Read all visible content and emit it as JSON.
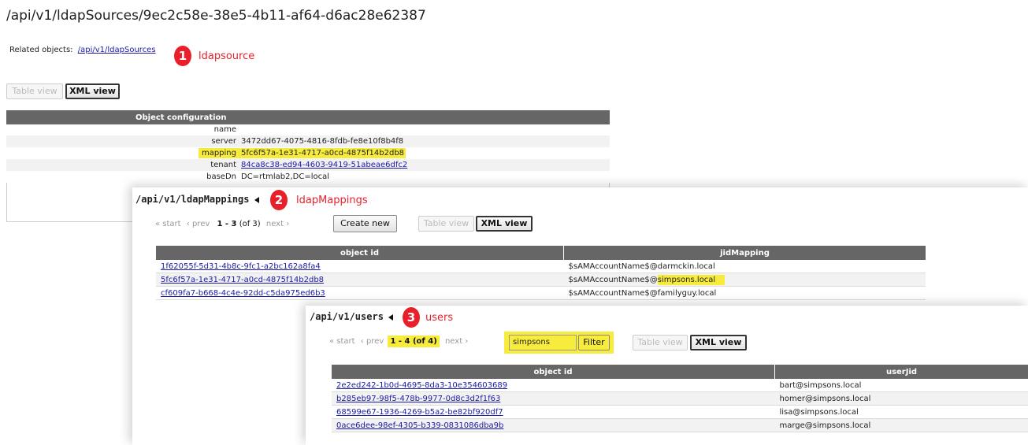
{
  "page_title": "/api/v1/ldapSources/9ec2c58e-38e5-4b11-af64-d6ac28e62387",
  "related": {
    "label": "Related objects:",
    "link": "/api/v1/ldapSources"
  },
  "annotations": [
    {
      "num": "1",
      "text": "ldapsource"
    },
    {
      "num": "2",
      "text": "ldapMappings"
    },
    {
      "num": "3",
      "text": "users"
    }
  ],
  "view_buttons": {
    "table": "Table view",
    "xml": "XML view"
  },
  "object_config": {
    "header": "Object configuration",
    "rows": [
      {
        "key": "name",
        "value": ""
      },
      {
        "key": "server",
        "value": "3472dd67-4075-4816-8fdb-fe8e10f8b4f8"
      },
      {
        "key": "mapping",
        "value": "5fc6f57a-1e31-4717-a0cd-4875f14b2db8"
      },
      {
        "key": "tenant",
        "value": "84ca8c38-ed94-4603-9419-51abeae6dfc2"
      },
      {
        "key": "baseDn",
        "value": "DC=rtmlab2,DC=local"
      }
    ]
  },
  "mappings": {
    "path": "/api/v1/ldapMappings",
    "pager": {
      "start": "« start",
      "prev": "‹ prev",
      "range": "1 - 3",
      "of": "(of 3)",
      "next": "next ›"
    },
    "create_label": "Create new",
    "columns": [
      "object id",
      "jidMapping"
    ],
    "rows": [
      {
        "id": "1f62055f-5d31-4b8c-9fc1-a2bc162a8fa4",
        "mapping": "$sAMAccountName$@darmckin.local"
      },
      {
        "id": "5fc6f57a-1e31-4717-a0cd-4875f14b2db8",
        "mapping_prefix": "$sAMAccountName$@",
        "mapping_hl": "simpsons.local"
      },
      {
        "id": "cf609fa7-b668-4c4e-92dd-c5da975ed6b3",
        "mapping": "$sAMAccountName$@familyguy.local"
      }
    ]
  },
  "users": {
    "path": "/api/v1/users",
    "pager": {
      "start": "« start",
      "prev": "‹ prev",
      "range": "1 - 4 (of 4)",
      "next": "next ›"
    },
    "filter_value": "simpsons",
    "filter_label": "Filter",
    "columns": [
      "object id",
      "userJid"
    ],
    "rows": [
      {
        "id": "2e2ed242-1b0d-4695-8da3-10e354603689",
        "jid": "bart@simpsons.local"
      },
      {
        "id": "b285eb97-98f5-478b-9977-0d8c3d2f1f63",
        "jid": "homer@simpsons.local"
      },
      {
        "id": "68599e67-1936-4269-b5a2-be82bf920df7",
        "jid": "lisa@simpsons.local"
      },
      {
        "id": "0ace6dee-98ef-4305-b339-0831086dba9b",
        "jid": "marge@simpsons.local"
      }
    ]
  },
  "colors": {
    "highlight": "#f7ec3b",
    "badge": "#e8202a",
    "header": "#666666"
  }
}
